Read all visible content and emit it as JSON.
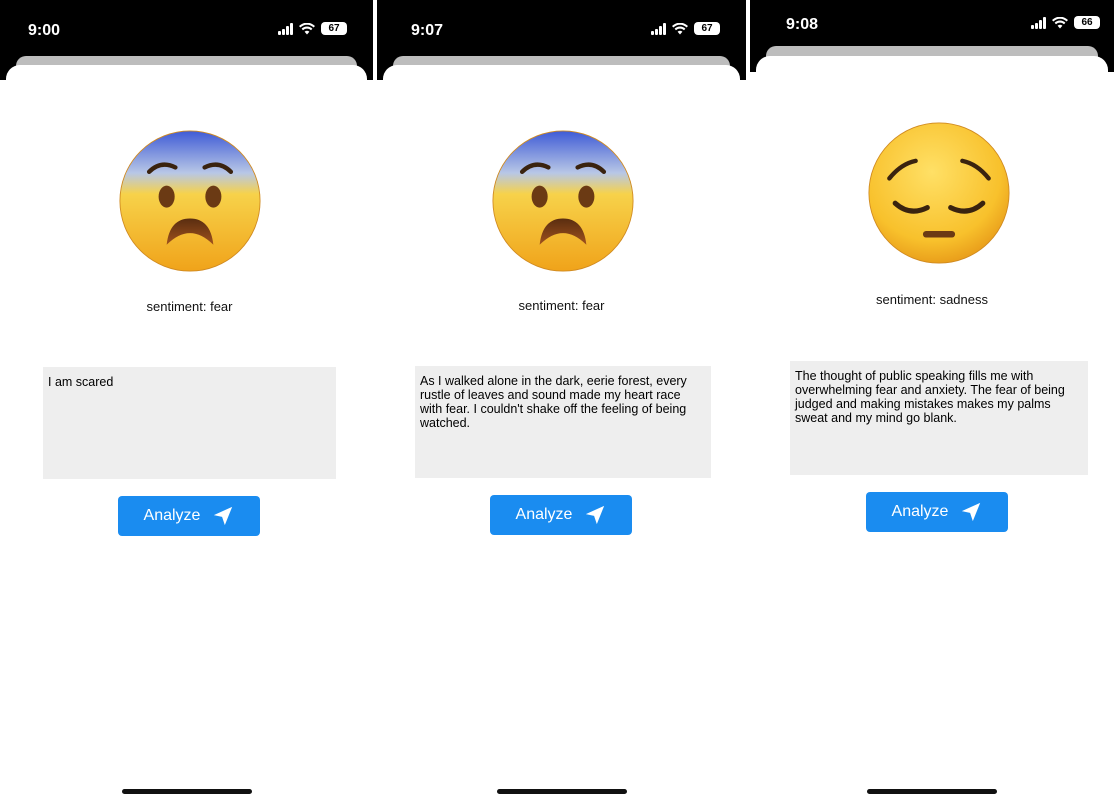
{
  "screens": [
    {
      "time": "9:00",
      "battery": "67",
      "emoji": "fearful-face-emoji",
      "sentiment": "sentiment: fear",
      "input_text": "I am scared",
      "button_label": "Analyze"
    },
    {
      "time": "9:07",
      "battery": "67",
      "emoji": "fearful-face-emoji",
      "sentiment": "sentiment: fear",
      "input_text": "As I walked alone in the dark, eerie forest, every rustle of leaves and sound made my heart race with fear. I couldn't shake off the feeling of being watched.",
      "button_label": "Analyze"
    },
    {
      "time": "9:08",
      "battery": "66",
      "emoji": "pensive-face-emoji",
      "sentiment": "sentiment: sadness",
      "input_text": "The thought of public speaking fills me with overwhelming fear and anxiety. The fear of being judged and making mistakes makes my palms sweat and my mind go blank.",
      "button_label": "Analyze"
    }
  ],
  "colors": {
    "button": "#1a8cf0",
    "textbox": "#eeeeee",
    "status_bar": "#000000"
  }
}
